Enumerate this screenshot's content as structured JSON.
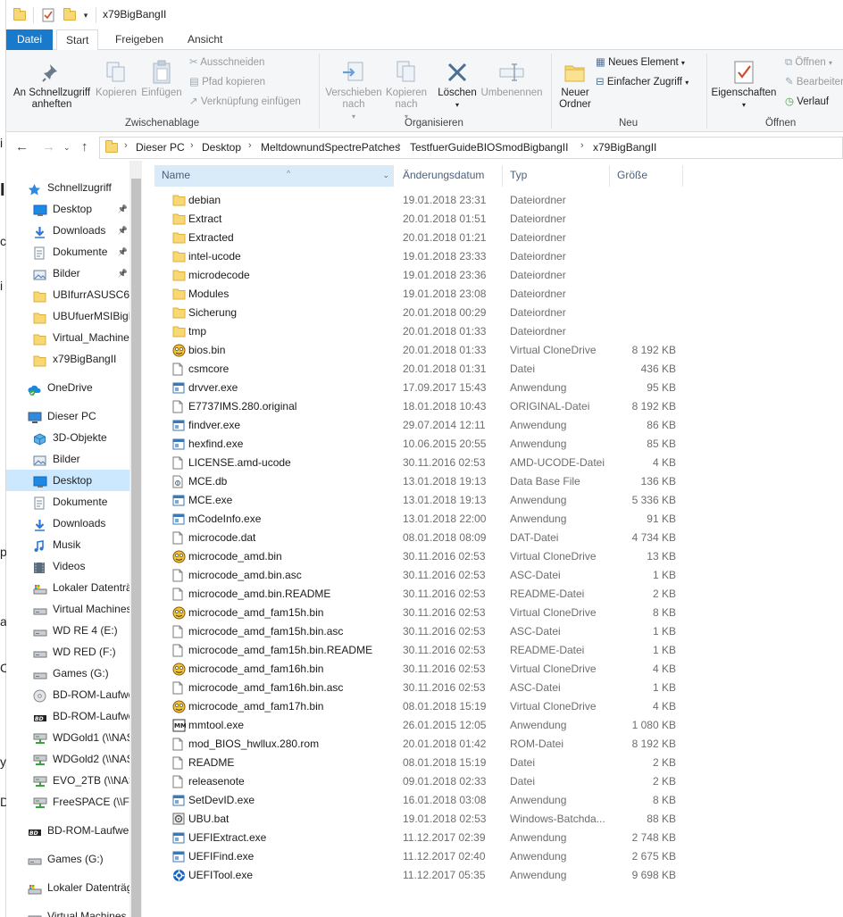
{
  "window": {
    "title": "x79BigBangII"
  },
  "ribbon_tabs": [
    "Datei",
    "Start",
    "Freigeben",
    "Ansicht"
  ],
  "ribbon": {
    "pin_quick": "An Schnellzugriff anheften",
    "copy": "Kopieren",
    "paste": "Einfügen",
    "cut": "Ausschneiden",
    "copy_path": "Pfad kopieren",
    "paste_shortcut": "Verknüpfung einfügen",
    "group_clipboard": "Zwischenablage",
    "move_to": "Verschieben nach",
    "copy_to": "Kopieren nach",
    "delete": "Löschen",
    "rename": "Umbenennen",
    "group_organize": "Organisieren",
    "new_folder": "Neuer Ordner",
    "new_item": "Neues Element",
    "easy_access": "Einfacher Zugriff",
    "group_new": "Neu",
    "properties": "Eigenschaften",
    "open": "Öffnen",
    "edit": "Bearbeiten",
    "history": "Verlauf",
    "group_open": "Öffnen"
  },
  "breadcrumb": [
    "Dieser PC",
    "Desktop",
    "MeltdownundSpectrePatches",
    "TestfuerGuideBIOSmodBigbangII",
    "x79BigBangII"
  ],
  "nav_items": [
    {
      "label": "Schnellzugriff",
      "icon": "star-icon",
      "pinned": false,
      "indent": 1
    },
    {
      "label": "Desktop",
      "icon": "desktop-icon",
      "pinned": true,
      "indent": 2
    },
    {
      "label": "Downloads",
      "icon": "download-icon",
      "pinned": true,
      "indent": 2
    },
    {
      "label": "Dokumente",
      "icon": "document-icon",
      "pinned": true,
      "indent": 2
    },
    {
      "label": "Bilder",
      "icon": "pictures-icon",
      "pinned": true,
      "indent": 2
    },
    {
      "label": "UBIfurrASUSC61...",
      "icon": "folder-icon",
      "pinned": false,
      "indent": 2
    },
    {
      "label": "UBUfuerMSIBigB",
      "icon": "folder-icon",
      "pinned": false,
      "indent": 2
    },
    {
      "label": "Virtual_Machine",
      "icon": "folder-icon",
      "pinned": false,
      "indent": 2
    },
    {
      "label": "x79BigBangII",
      "icon": "folder-icon",
      "pinned": false,
      "indent": 2
    },
    {
      "label": "OneDrive",
      "icon": "onedrive-icon",
      "pinned": false,
      "indent": 1
    },
    {
      "label": "Dieser PC",
      "icon": "pc-icon",
      "pinned": false,
      "indent": 1
    },
    {
      "label": "3D-Objekte",
      "icon": "3d-objects-icon",
      "pinned": false,
      "indent": 2
    },
    {
      "label": "Bilder",
      "icon": "pictures-icon",
      "pinned": false,
      "indent": 2
    },
    {
      "label": "Desktop",
      "icon": "desktop-icon",
      "pinned": false,
      "indent": 2
    },
    {
      "label": "Dokumente",
      "icon": "document-icon",
      "pinned": false,
      "indent": 2
    },
    {
      "label": "Downloads",
      "icon": "download-icon",
      "pinned": false,
      "indent": 2
    },
    {
      "label": "Musik",
      "icon": "music-icon",
      "pinned": false,
      "indent": 2
    },
    {
      "label": "Videos",
      "icon": "video-icon",
      "pinned": false,
      "indent": 2
    },
    {
      "label": "Lokaler Datenträ",
      "icon": "system-drive-icon",
      "pinned": false,
      "indent": 2
    },
    {
      "label": "Virtual Machines",
      "icon": "drive-icon",
      "pinned": false,
      "indent": 2
    },
    {
      "label": "WD RE 4 (E:)",
      "icon": "drive-icon",
      "pinned": false,
      "indent": 2
    },
    {
      "label": "WD RED (F:)",
      "icon": "drive-icon",
      "pinned": false,
      "indent": 2
    },
    {
      "label": "Games (G:)",
      "icon": "drive-icon",
      "pinned": false,
      "indent": 2
    },
    {
      "label": "BD-ROM-Laufwe",
      "icon": "disc-icon",
      "pinned": false,
      "indent": 2
    },
    {
      "label": "BD-ROM-Laufwe",
      "icon": "bd-drive-icon",
      "pinned": false,
      "indent": 2
    },
    {
      "label": "WDGold1 (\\\\NAS",
      "icon": "network-drive-icon",
      "pinned": false,
      "indent": 2
    },
    {
      "label": "WDGold2 (\\\\NAS",
      "icon": "network-drive-icon",
      "pinned": false,
      "indent": 2
    },
    {
      "label": "EVO_2TB (\\\\NAS",
      "icon": "network-drive-icon",
      "pinned": false,
      "indent": 2
    },
    {
      "label": "FreeSPACE (\\\\Fre",
      "icon": "network-drive-icon",
      "pinned": false,
      "indent": 2
    },
    {
      "label": "BD-ROM-Laufwer",
      "icon": "bd-drive-icon",
      "pinned": false,
      "indent": 1
    },
    {
      "label": "Games (G:)",
      "icon": "drive-icon",
      "pinned": false,
      "indent": 1
    },
    {
      "label": "Lokaler Datenträg",
      "icon": "system-drive-icon",
      "pinned": false,
      "indent": 1
    },
    {
      "label": "Virtual Machines (",
      "icon": "drive-icon",
      "pinned": false,
      "indent": 1
    }
  ],
  "columns": {
    "name": "Name",
    "date": "Änderungsdatum",
    "type": "Typ",
    "size": "Größe"
  },
  "files": [
    {
      "name": "debian",
      "date": "19.01.2018 23:31",
      "type": "Dateiordner",
      "size": "",
      "icon": "folder-icon"
    },
    {
      "name": "Extract",
      "date": "20.01.2018 01:51",
      "type": "Dateiordner",
      "size": "",
      "icon": "folder-icon"
    },
    {
      "name": "Extracted",
      "date": "20.01.2018 01:21",
      "type": "Dateiordner",
      "size": "",
      "icon": "folder-icon"
    },
    {
      "name": "intel-ucode",
      "date": "19.01.2018 23:33",
      "type": "Dateiordner",
      "size": "",
      "icon": "folder-icon"
    },
    {
      "name": "microdecode",
      "date": "19.01.2018 23:36",
      "type": "Dateiordner",
      "size": "",
      "icon": "folder-icon"
    },
    {
      "name": "Modules",
      "date": "19.01.2018 23:08",
      "type": "Dateiordner",
      "size": "",
      "icon": "folder-icon"
    },
    {
      "name": "Sicherung",
      "date": "20.01.2018 00:29",
      "type": "Dateiordner",
      "size": "",
      "icon": "folder-icon"
    },
    {
      "name": "tmp",
      "date": "20.01.2018 01:33",
      "type": "Dateiordner",
      "size": "",
      "icon": "folder-icon"
    },
    {
      "name": "bios.bin",
      "date": "20.01.2018 01:33",
      "type": "Virtual CloneDrive",
      "size": "8 192 KB",
      "icon": "clonedrive-icon"
    },
    {
      "name": "csmcore",
      "date": "20.01.2018 01:31",
      "type": "Datei",
      "size": "436 KB",
      "icon": "file-icon"
    },
    {
      "name": "drvver.exe",
      "date": "17.09.2017 15:43",
      "type": "Anwendung",
      "size": "95 KB",
      "icon": "exe-icon"
    },
    {
      "name": "E7737IMS.280.original",
      "date": "18.01.2018 10:43",
      "type": "ORIGINAL-Datei",
      "size": "8 192 KB",
      "icon": "file-icon"
    },
    {
      "name": "findver.exe",
      "date": "29.07.2014 12:11",
      "type": "Anwendung",
      "size": "86 KB",
      "icon": "exe-icon"
    },
    {
      "name": "hexfind.exe",
      "date": "10.06.2015 20:55",
      "type": "Anwendung",
      "size": "85 KB",
      "icon": "exe-icon"
    },
    {
      "name": "LICENSE.amd-ucode",
      "date": "30.11.2016 02:53",
      "type": "AMD-UCODE-Datei",
      "size": "4 KB",
      "icon": "file-icon"
    },
    {
      "name": "MCE.db",
      "date": "13.01.2018 19:13",
      "type": "Data Base File",
      "size": "136 KB",
      "icon": "db-icon"
    },
    {
      "name": "MCE.exe",
      "date": "13.01.2018 19:13",
      "type": "Anwendung",
      "size": "5 336 KB",
      "icon": "exe-icon"
    },
    {
      "name": "mCodeInfo.exe",
      "date": "13.01.2018 22:00",
      "type": "Anwendung",
      "size": "91 KB",
      "icon": "exe-icon"
    },
    {
      "name": "microcode.dat",
      "date": "08.01.2018 08:09",
      "type": "DAT-Datei",
      "size": "4 734 KB",
      "icon": "file-icon"
    },
    {
      "name": "microcode_amd.bin",
      "date": "30.11.2016 02:53",
      "type": "Virtual CloneDrive",
      "size": "13 KB",
      "icon": "clonedrive-icon"
    },
    {
      "name": "microcode_amd.bin.asc",
      "date": "30.11.2016 02:53",
      "type": "ASC-Datei",
      "size": "1 KB",
      "icon": "file-icon"
    },
    {
      "name": "microcode_amd.bin.README",
      "date": "30.11.2016 02:53",
      "type": "README-Datei",
      "size": "2 KB",
      "icon": "file-icon"
    },
    {
      "name": "microcode_amd_fam15h.bin",
      "date": "30.11.2016 02:53",
      "type": "Virtual CloneDrive",
      "size": "8 KB",
      "icon": "clonedrive-icon"
    },
    {
      "name": "microcode_amd_fam15h.bin.asc",
      "date": "30.11.2016 02:53",
      "type": "ASC-Datei",
      "size": "1 KB",
      "icon": "file-icon"
    },
    {
      "name": "microcode_amd_fam15h.bin.README",
      "date": "30.11.2016 02:53",
      "type": "README-Datei",
      "size": "1 KB",
      "icon": "file-icon"
    },
    {
      "name": "microcode_amd_fam16h.bin",
      "date": "30.11.2016 02:53",
      "type": "Virtual CloneDrive",
      "size": "4 KB",
      "icon": "clonedrive-icon"
    },
    {
      "name": "microcode_amd_fam16h.bin.asc",
      "date": "30.11.2016 02:53",
      "type": "ASC-Datei",
      "size": "1 KB",
      "icon": "file-icon"
    },
    {
      "name": "microcode_amd_fam17h.bin",
      "date": "08.01.2018 15:19",
      "type": "Virtual CloneDrive",
      "size": "4 KB",
      "icon": "clonedrive-icon"
    },
    {
      "name": "mmtool.exe",
      "date": "26.01.2015 12:05",
      "type": "Anwendung",
      "size": "1 080 KB",
      "icon": "mmtool-icon"
    },
    {
      "name": "mod_BIOS_hwllux.280.rom",
      "date": "20.01.2018 01:42",
      "type": "ROM-Datei",
      "size": "8 192 KB",
      "icon": "file-icon"
    },
    {
      "name": "README",
      "date": "08.01.2018 15:19",
      "type": "Datei",
      "size": "2 KB",
      "icon": "file-icon"
    },
    {
      "name": "releasenote",
      "date": "09.01.2018 02:33",
      "type": "Datei",
      "size": "2 KB",
      "icon": "file-icon"
    },
    {
      "name": "SetDevID.exe",
      "date": "16.01.2018 03:08",
      "type": "Anwendung",
      "size": "8 KB",
      "icon": "exe-icon"
    },
    {
      "name": "UBU.bat",
      "date": "19.01.2018 02:53",
      "type": "Windows-Batchda...",
      "size": "88 KB",
      "icon": "bat-icon"
    },
    {
      "name": "UEFIExtract.exe",
      "date": "11.12.2017 02:39",
      "type": "Anwendung",
      "size": "2 748 KB",
      "icon": "exe-icon"
    },
    {
      "name": "UEFIFind.exe",
      "date": "11.12.2017 02:40",
      "type": "Anwendung",
      "size": "2 675 KB",
      "icon": "exe-icon"
    },
    {
      "name": "UEFITool.exe",
      "date": "11.12.2017 05:35",
      "type": "Anwendung",
      "size": "9 698 KB",
      "icon": "uefitool-icon"
    }
  ]
}
